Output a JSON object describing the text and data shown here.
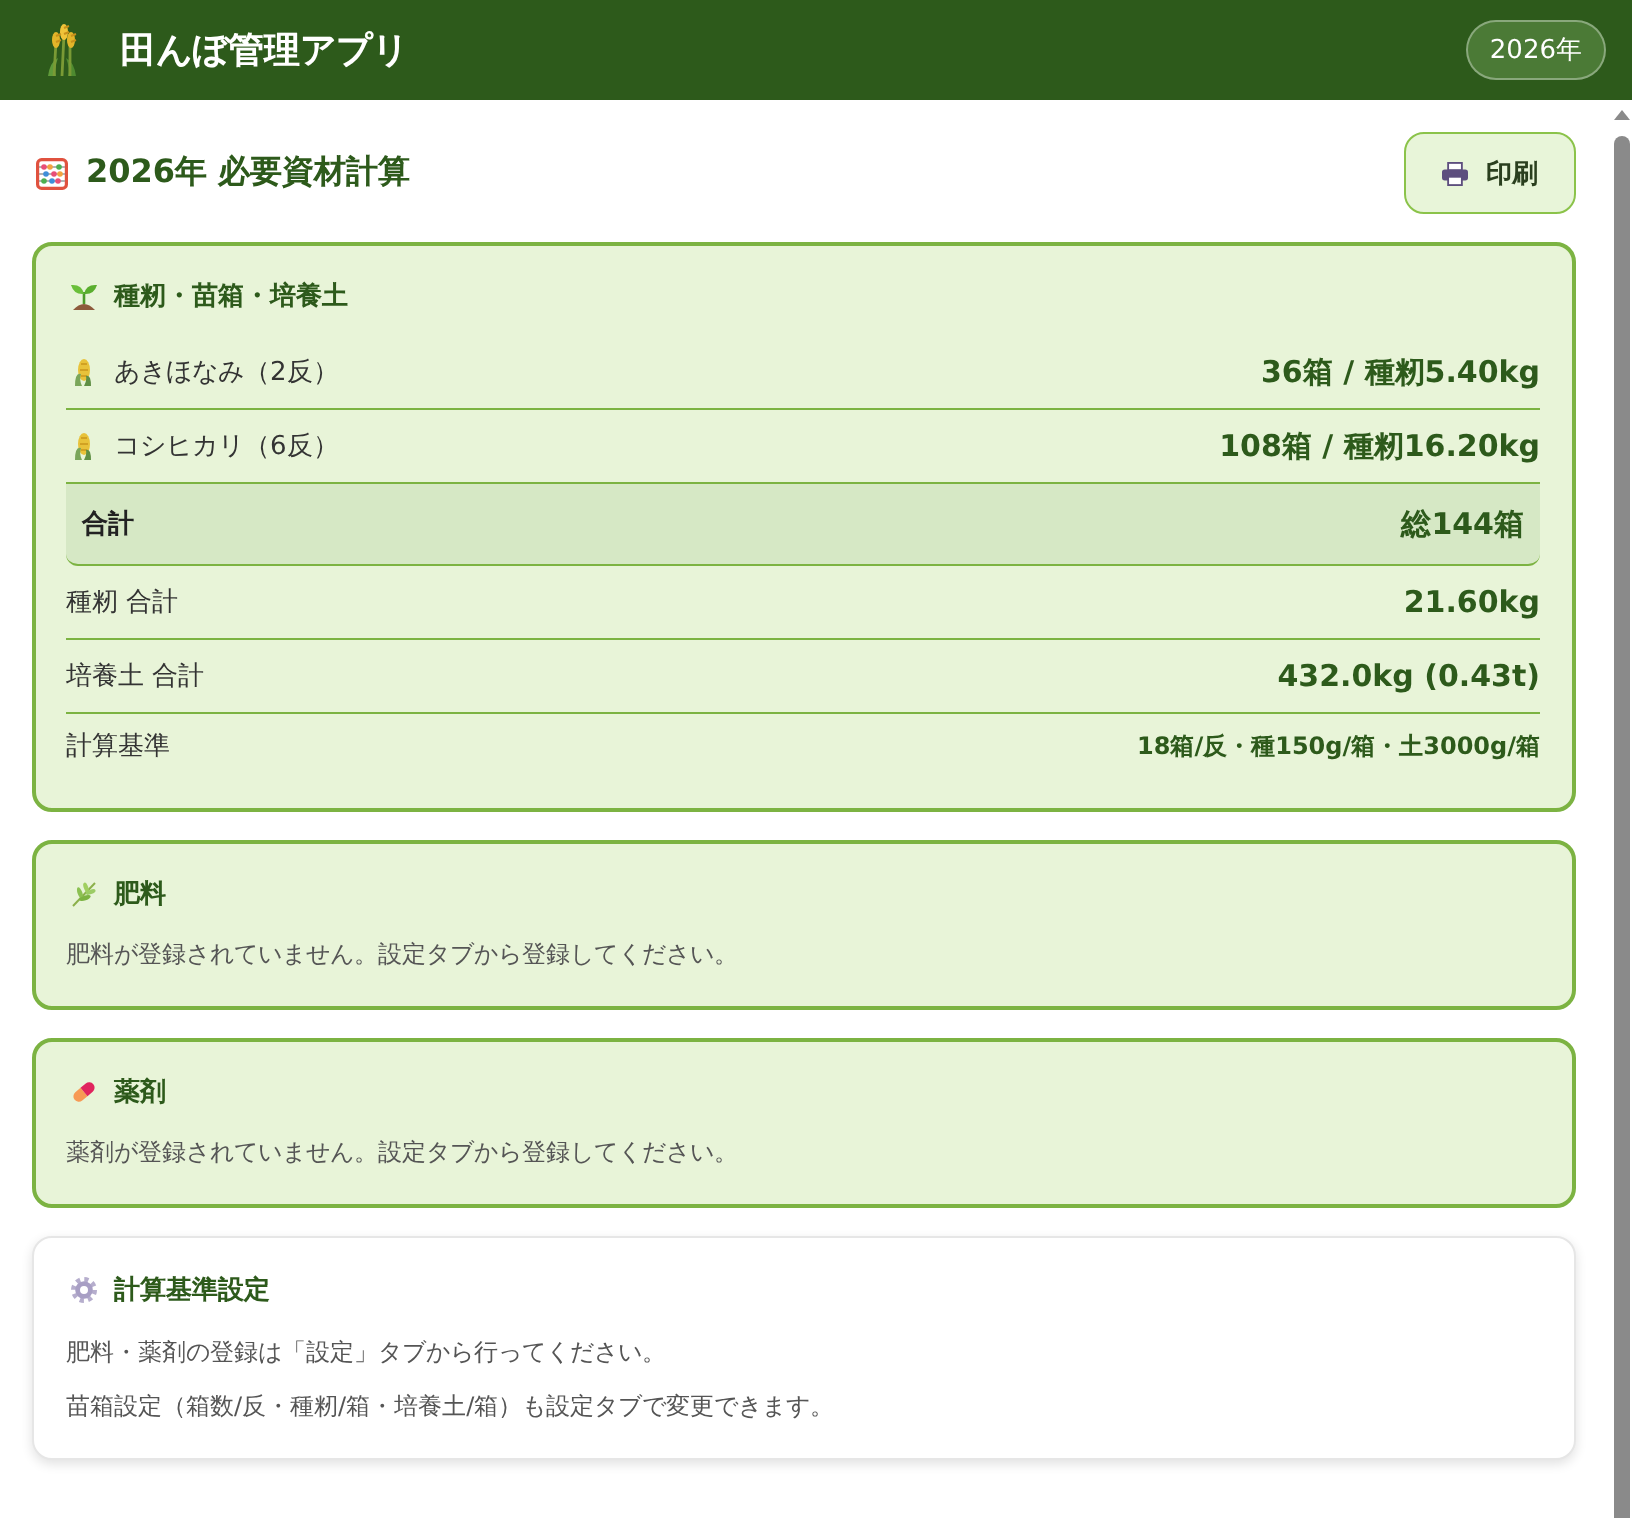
{
  "app_bar": {
    "title": "田んぼ管理アプリ",
    "year": "2026年"
  },
  "page_header": {
    "title": "2026年 必要資材計算",
    "print_button": "印刷"
  },
  "seedling_materials": {
    "title": "種籾・苗箱・培養土",
    "rows": [
      {
        "kind": "variety",
        "label": "あきほなみ（2反）",
        "value": "36箱 / 種籾5.40kg"
      },
      {
        "kind": "variety",
        "label": "コシヒカリ（6反）",
        "value": "108箱 / 種籾16.20kg"
      },
      {
        "kind": "total",
        "label": "合計",
        "value": "総144箱"
      },
      {
        "kind": "sum",
        "label": "種籾 合計",
        "value": "21.60kg"
      },
      {
        "kind": "sum",
        "label": "培養土 合計",
        "value": "432.0kg (0.43t)"
      },
      {
        "kind": "basis",
        "label": "計算基準",
        "value": "18箱/反・種150g/箱・土3000g/箱"
      }
    ]
  },
  "fertilizer": {
    "title": "肥料",
    "message": "肥料が登録されていません。設定タブから登録してください。"
  },
  "pesticide": {
    "title": "薬剤",
    "message": "薬剤が登録されていません。設定タブから登録してください。"
  },
  "calculation_settings": {
    "title": "計算基準設定",
    "lines": [
      "肥料・薬剤の登録は「設定」タブから行ってください。",
      "苗箱設定（箱数/反・種籾/箱・培養土/箱）も設定タブで変更できます。"
    ]
  }
}
